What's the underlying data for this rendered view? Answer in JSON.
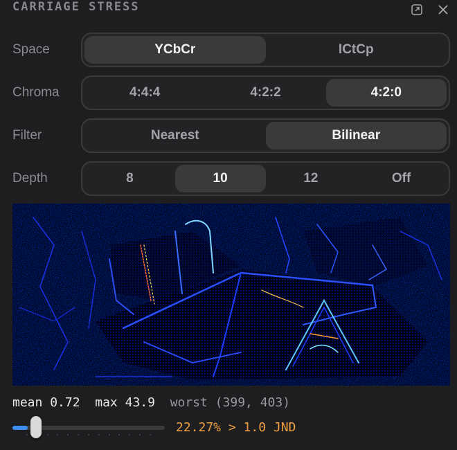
{
  "panel": {
    "title": "CARRIAGE STRESS",
    "popout_icon": "popout-icon",
    "close_icon": "close-icon"
  },
  "controls": {
    "space": {
      "label": "Space",
      "options": [
        "YCbCr",
        "ICtCp"
      ],
      "selected": "YCbCr"
    },
    "chroma": {
      "label": "Chroma",
      "options": [
        "4:4:4",
        "4:2:2",
        "4:2:0"
      ],
      "selected": "4:2:0"
    },
    "filter": {
      "label": "Filter",
      "options": [
        "Nearest",
        "Bilinear"
      ],
      "selected": "Bilinear"
    },
    "depth": {
      "label": "Depth",
      "options": [
        "8",
        "10",
        "12",
        "Off"
      ],
      "selected": "10"
    }
  },
  "heatmap": {
    "name": "error-heatmap"
  },
  "stats": {
    "mean_label": "mean",
    "mean_value": "0.72",
    "max_label": "max",
    "max_value": "43.9",
    "worst_text": "worst (399, 403)"
  },
  "threshold": {
    "slider_value": 0.1,
    "readout": "22.27% > 1.0 JND"
  },
  "colors": {
    "accent": "#3d8ef0",
    "warning": "#f0a040",
    "background": "#1e1e20"
  }
}
